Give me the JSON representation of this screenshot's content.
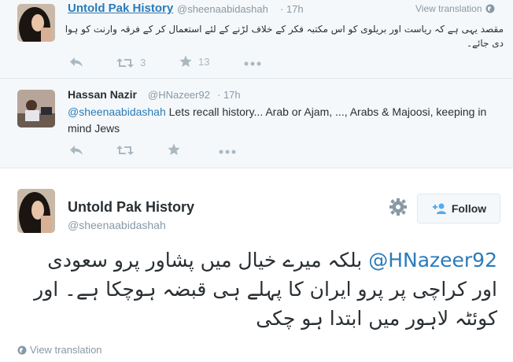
{
  "tweets": [
    {
      "name": "Untold Pak History",
      "handle": "@sheenaabidashah",
      "time": "17h",
      "view_translation": "View translation",
      "text": "مقصد یہی ہے کہ ریاست اور بریلوی کو اس مکتبہ فکر کے خلاف لڑنے کے لئے استعمال کر کے فرقہ وارنت کو ہوا دی جائے۔",
      "retweets": "3",
      "favorites": "13"
    },
    {
      "name": "Hassan Nazir",
      "handle": "@HNazeer92",
      "time": "17h",
      "mention": "@sheenaabidashah",
      "text": " Lets recall history... Arab or Ajam, ..., Arabs & Majoosi, keeping in mind Jews"
    }
  ],
  "main_tweet": {
    "name": "Untold Pak History",
    "handle": "@sheenaabidashah",
    "follow_label": "Follow",
    "mention": "@HNazeer92",
    "text": "بلکہ میرے خیال میں پشاور پرو سعودی اور کراچی پر پرو ایران کا پہلے ہی قبضہ ہوچکا ہے۔ اور کوئٹہ لاہور میں ابتدا ہو چکی",
    "view_translation": "View translation"
  },
  "colors": {
    "link": "#2b7bb9",
    "muted": "#8899a6",
    "icon": "#aab8c2",
    "panel": "#f5f8fa"
  },
  "icons": [
    "reply-icon",
    "retweet-icon",
    "star-icon",
    "more-icon",
    "globe-icon",
    "gear-icon",
    "add-user-icon"
  ]
}
